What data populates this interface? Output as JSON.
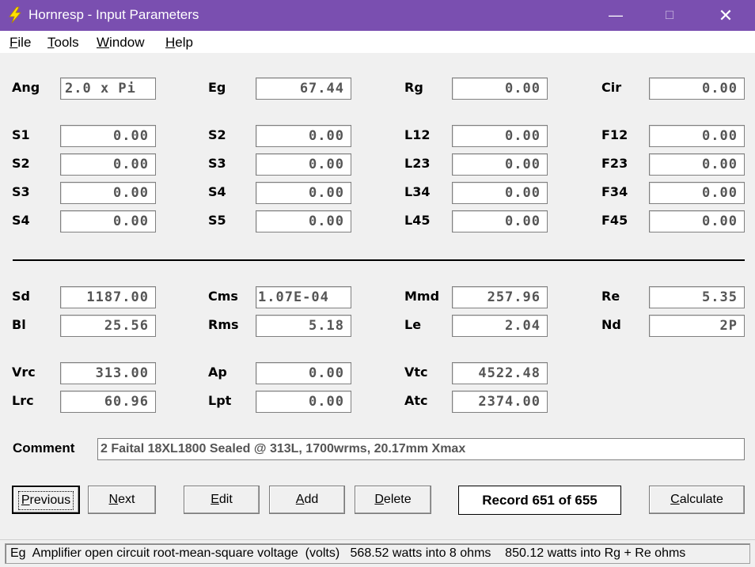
{
  "window": {
    "title": "Hornresp - Input Parameters",
    "min_glyph": "—",
    "max_glyph": "☐",
    "close_glyph": "✕"
  },
  "menu": {
    "file_u": "F",
    "file_rest": "ile",
    "tools_u": "T",
    "tools_rest": "ools",
    "window_u": "W",
    "window_rest": "indow",
    "help_u": "H",
    "help_rest": "elp"
  },
  "params": {
    "ang": {
      "label": "Ang",
      "value": "2.0 x Pi"
    },
    "eg": {
      "label": "Eg",
      "value": "67.44"
    },
    "rg": {
      "label": "Rg",
      "value": "0.00"
    },
    "cir": {
      "label": "Cir",
      "value": "0.00"
    },
    "s1": {
      "label": "S1",
      "value": "0.00"
    },
    "s2a": {
      "label": "S2",
      "value": "0.00"
    },
    "l12": {
      "label": "L12",
      "value": "0.00"
    },
    "f12": {
      "label": "F12",
      "value": "0.00"
    },
    "s2b": {
      "label": "S2",
      "value": "0.00"
    },
    "s3a": {
      "label": "S3",
      "value": "0.00"
    },
    "l23": {
      "label": "L23",
      "value": "0.00"
    },
    "f23": {
      "label": "F23",
      "value": "0.00"
    },
    "s3b": {
      "label": "S3",
      "value": "0.00"
    },
    "s4a": {
      "label": "S4",
      "value": "0.00"
    },
    "l34": {
      "label": "L34",
      "value": "0.00"
    },
    "f34": {
      "label": "F34",
      "value": "0.00"
    },
    "s4b": {
      "label": "S4",
      "value": "0.00"
    },
    "s5": {
      "label": "S5",
      "value": "0.00"
    },
    "l45": {
      "label": "L45",
      "value": "0.00"
    },
    "f45": {
      "label": "F45",
      "value": "0.00"
    },
    "sd": {
      "label": "Sd",
      "value": "1187.00"
    },
    "cms": {
      "label": "Cms",
      "value": "1.07E-04"
    },
    "mmd": {
      "label": "Mmd",
      "value": "257.96"
    },
    "re": {
      "label": "Re",
      "value": "5.35"
    },
    "bl": {
      "label": "Bl",
      "value": "25.56"
    },
    "rms": {
      "label": "Rms",
      "value": "5.18"
    },
    "le": {
      "label": "Le",
      "value": "2.04"
    },
    "nd": {
      "label": "Nd",
      "value": "2P"
    },
    "vrc": {
      "label": "Vrc",
      "value": "313.00"
    },
    "ap": {
      "label": "Ap",
      "value": "0.00"
    },
    "vtc": {
      "label": "Vtc",
      "value": "4522.48"
    },
    "lrc": {
      "label": "Lrc",
      "value": "60.96"
    },
    "lpt": {
      "label": "Lpt",
      "value": "0.00"
    },
    "atc": {
      "label": "Atc",
      "value": "2374.00"
    }
  },
  "comment": {
    "label": "Comment",
    "value": "2 Faital 18XL1800 Sealed @ 313L, 1700wrms, 20.17mm Xmax"
  },
  "buttons": {
    "previous_u": "P",
    "previous_rest": "revious",
    "next_u": "N",
    "next_rest": "ext",
    "edit_u": "E",
    "edit_rest": "dit",
    "add_u": "A",
    "add_rest": "dd",
    "delete_u": "D",
    "delete_rest": "elete",
    "calculate_u": "C",
    "calculate_rest": "alculate"
  },
  "record": "Record 651 of 655",
  "status": "Eg  Amplifier open circuit root-mean-square voltage  (volts)   568.52 watts into 8 ohms    850.12 watts into Rg + Re ohms"
}
